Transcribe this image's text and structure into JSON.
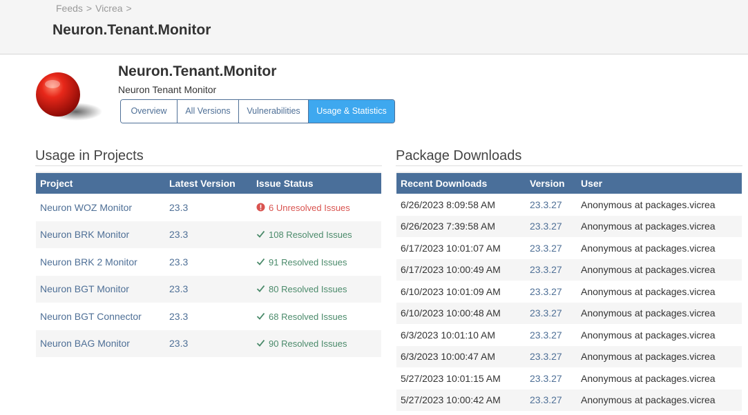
{
  "breadcrumb": [
    "Feeds",
    "Vicrea"
  ],
  "breadcrumb_separator": ">",
  "header_title": "Neuron.Tenant.Monitor",
  "package": {
    "title": "Neuron.Tenant.Monitor",
    "description": "Neuron Tenant Monitor",
    "logo_icon": "red-ball-icon"
  },
  "tabs": [
    {
      "label": "Overview",
      "active": false
    },
    {
      "label": "All Versions",
      "active": false
    },
    {
      "label": "Vulnerabilities",
      "active": false
    },
    {
      "label": "Usage & Statistics",
      "active": true
    }
  ],
  "usage": {
    "title": "Usage in Projects",
    "columns": [
      "Project",
      "Latest Version",
      "Issue Status"
    ],
    "rows": [
      {
        "project": "Neuron WOZ Monitor",
        "version": "23.3",
        "status": "6 Unresolved Issues",
        "ok": false
      },
      {
        "project": "Neuron BRK Monitor",
        "version": "23.3",
        "status": "108 Resolved Issues",
        "ok": true
      },
      {
        "project": "Neuron BRK 2 Monitor",
        "version": "23.3",
        "status": "91 Resolved Issues",
        "ok": true
      },
      {
        "project": "Neuron BGT Monitor",
        "version": "23.3",
        "status": "80 Resolved Issues",
        "ok": true
      },
      {
        "project": "Neuron BGT Connector",
        "version": "23.3",
        "status": "68 Resolved Issues",
        "ok": true
      },
      {
        "project": "Neuron BAG Monitor",
        "version": "23.3",
        "status": "90 Resolved Issues",
        "ok": true
      }
    ]
  },
  "downloads": {
    "title": "Package Downloads",
    "columns": [
      "Recent Downloads",
      "Version",
      "User"
    ],
    "rows": [
      {
        "date": "6/26/2023 8:09:58 AM",
        "version": "23.3.27",
        "user": "Anonymous at packages.vicrea"
      },
      {
        "date": "6/26/2023 7:39:58 AM",
        "version": "23.3.27",
        "user": "Anonymous at packages.vicrea"
      },
      {
        "date": "6/17/2023 10:01:07 AM",
        "version": "23.3.27",
        "user": "Anonymous at packages.vicrea"
      },
      {
        "date": "6/17/2023 10:00:49 AM",
        "version": "23.3.27",
        "user": "Anonymous at packages.vicrea"
      },
      {
        "date": "6/10/2023 10:01:09 AM",
        "version": "23.3.27",
        "user": "Anonymous at packages.vicrea"
      },
      {
        "date": "6/10/2023 10:00:48 AM",
        "version": "23.3.27",
        "user": "Anonymous at packages.vicrea"
      },
      {
        "date": "6/3/2023 10:01:10 AM",
        "version": "23.3.27",
        "user": "Anonymous at packages.vicrea"
      },
      {
        "date": "6/3/2023 10:00:47 AM",
        "version": "23.3.27",
        "user": "Anonymous at packages.vicrea"
      },
      {
        "date": "5/27/2023 10:01:15 AM",
        "version": "23.3.27",
        "user": "Anonymous at packages.vicrea"
      },
      {
        "date": "5/27/2023 10:00:42 AM",
        "version": "23.3.27",
        "user": "Anonymous at packages.vicrea"
      }
    ]
  },
  "colors": {
    "header_bg": "#4a6f9a",
    "active_tab": "#3ea8ef",
    "link": "#4e6f96",
    "error": "#d9534f",
    "success": "#4a8a6a"
  }
}
